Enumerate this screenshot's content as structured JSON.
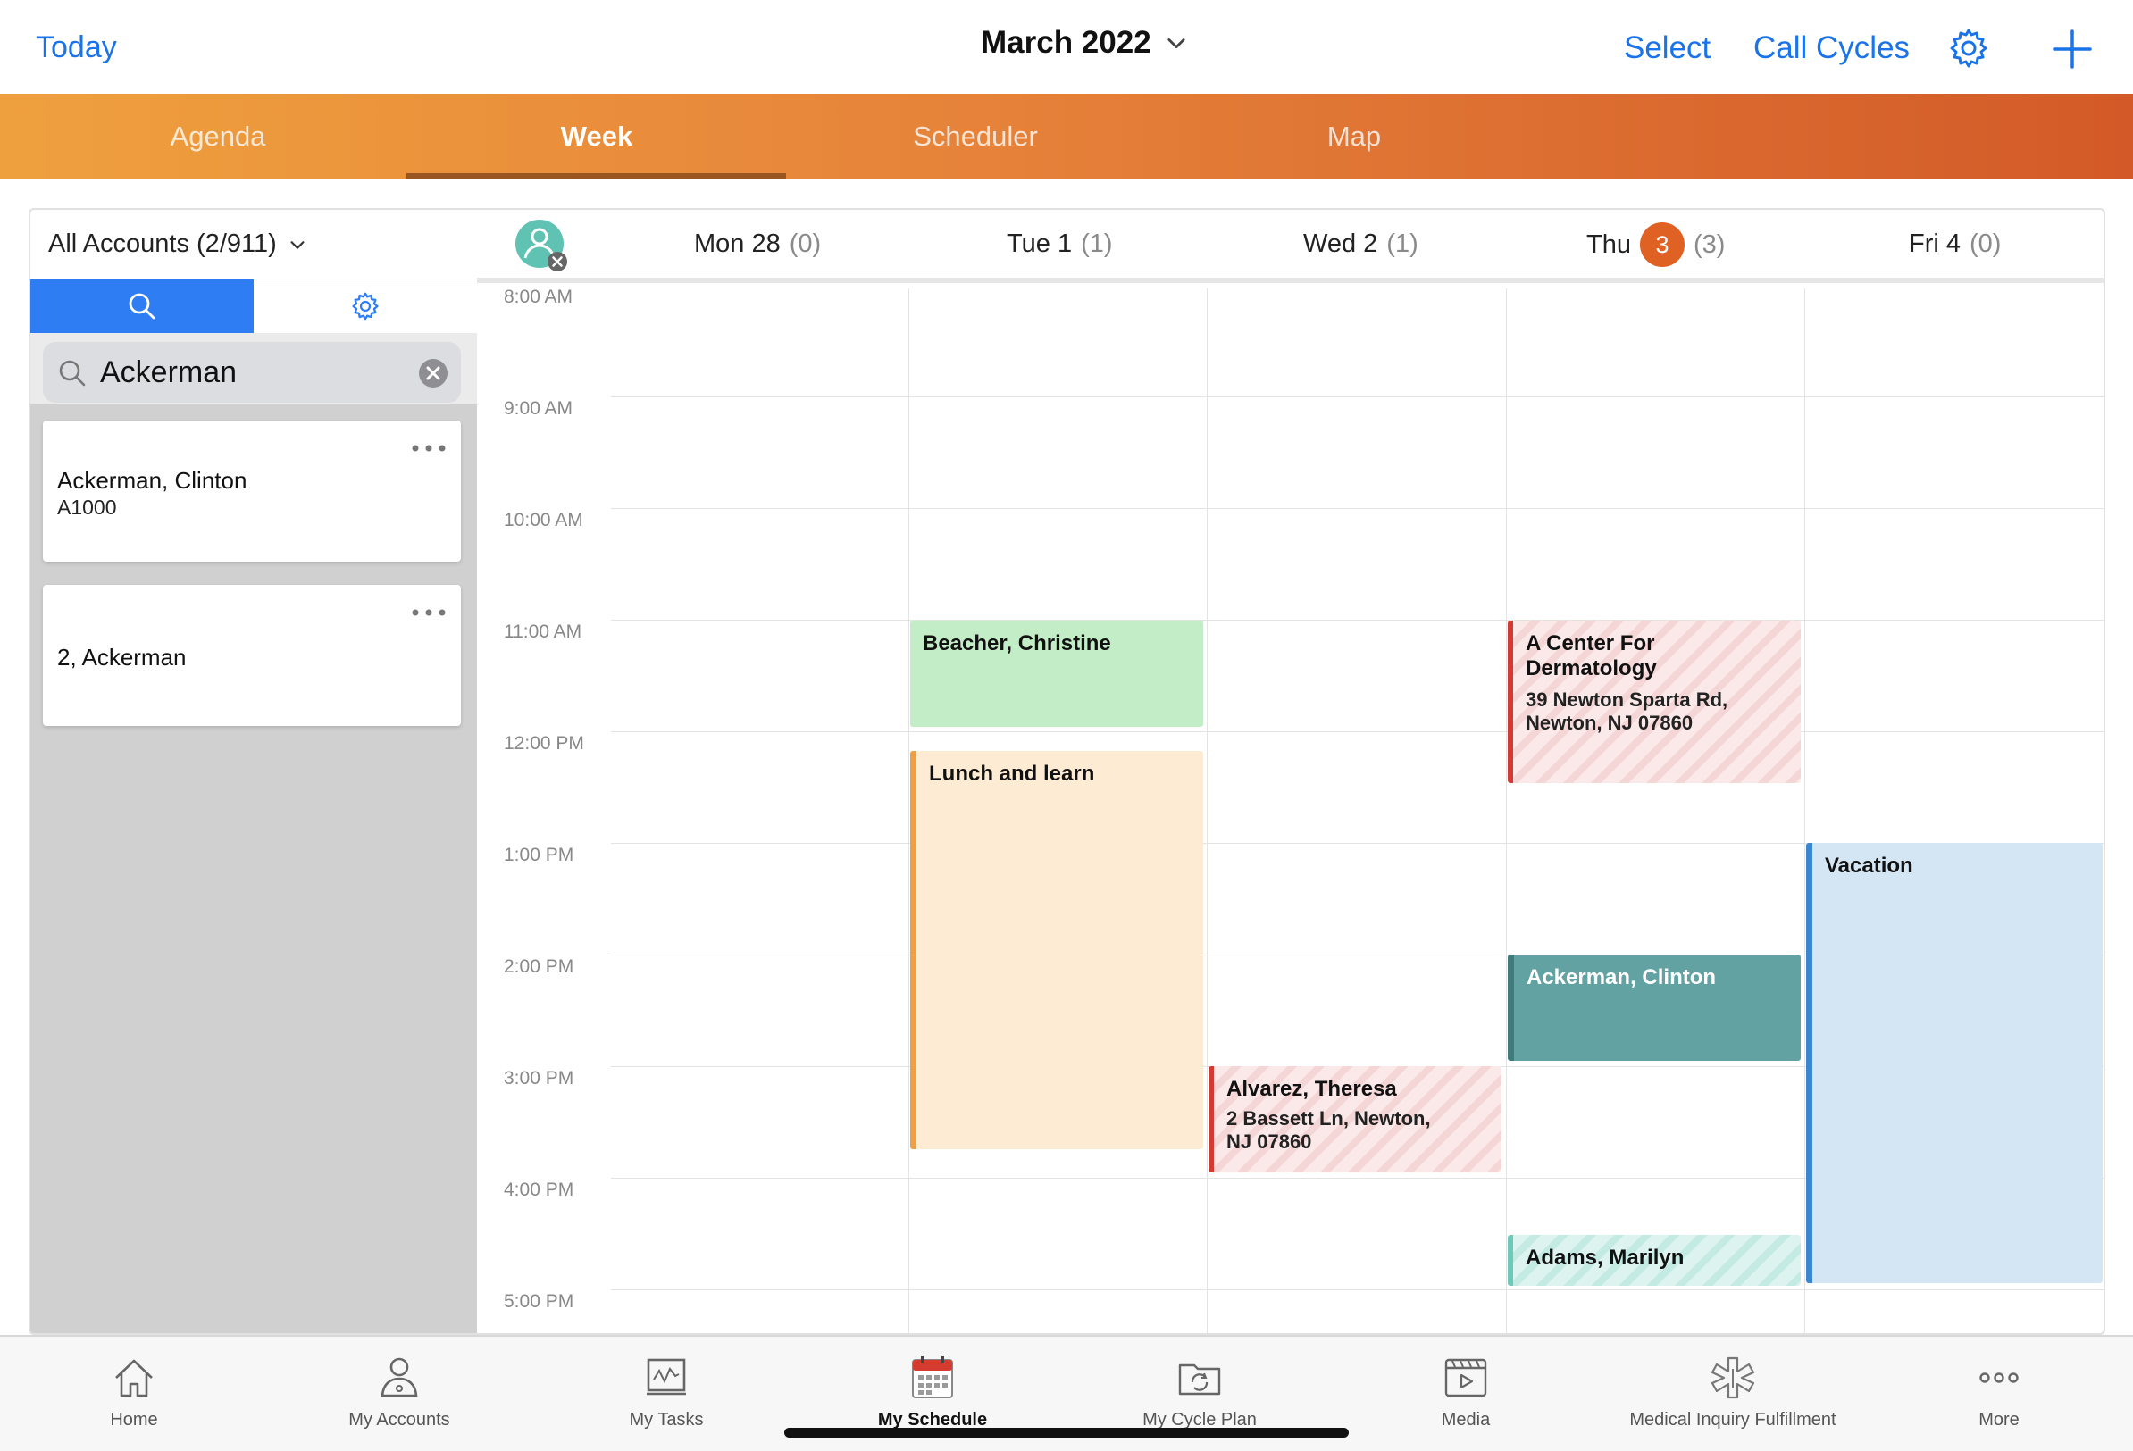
{
  "topnav": {
    "today_label": "Today",
    "month_title": "March 2022",
    "select_label": "Select",
    "call_cycles_label": "Call Cycles"
  },
  "tabs": [
    {
      "label": "Agenda",
      "active": false
    },
    {
      "label": "Week",
      "active": true
    },
    {
      "label": "Scheduler",
      "active": false
    },
    {
      "label": "Map",
      "active": false
    }
  ],
  "left_panel": {
    "accounts_filter": "All Accounts (2/911)",
    "search_value": "Ackerman",
    "results": [
      {
        "name": "Ackerman, Clinton",
        "id": "A1000"
      },
      {
        "name": "2, Ackerman",
        "id": ""
      }
    ]
  },
  "days": [
    {
      "name": "Mon 28",
      "count": "(0)"
    },
    {
      "name": "Tue 1",
      "count": "(1)"
    },
    {
      "name": "Wed 2",
      "count": "(1)"
    },
    {
      "name": "Thu",
      "date_badge": "3",
      "count": "(3)"
    },
    {
      "name": "Fri 4",
      "count": "(0)"
    }
  ],
  "times": [
    "8:00 AM",
    "9:00 AM",
    "10:00 AM",
    "11:00 AM",
    "12:00 PM",
    "1:00 PM",
    "2:00 PM",
    "3:00 PM",
    "4:00 PM",
    "5:00 PM"
  ],
  "events": {
    "beacher": {
      "title": "Beacher, Christine"
    },
    "lunch": {
      "title": "Lunch and learn"
    },
    "alvarez": {
      "title": "Alvarez, Theresa",
      "address": "2 Bassett Ln, Newton,",
      "address2": "NJ 07860"
    },
    "dermatology": {
      "title": "A Center For",
      "title2": "Dermatology",
      "address": "39 Newton Sparta Rd,",
      "address2": "Newton, NJ 07860"
    },
    "ackerman": {
      "title": "Ackerman, Clinton"
    },
    "adams": {
      "title": "Adams, Marilyn"
    },
    "vacation": {
      "title": "Vacation"
    }
  },
  "colors": {
    "accent_blue": "#1a73e8",
    "today_badge": "#e06124",
    "event_green": "#c3edc6",
    "event_lunch": "#fdebd3",
    "event_lunch_bar": "#eda044",
    "event_teal": "#62a2a2",
    "event_vacation": "#d4e6f4",
    "event_vacation_bar": "#3a86d0"
  },
  "bottom_tabs": [
    {
      "label": "Home",
      "icon": "home-icon"
    },
    {
      "label": "My Accounts",
      "icon": "accounts-icon"
    },
    {
      "label": "My Tasks",
      "icon": "tasks-icon"
    },
    {
      "label": "My Schedule",
      "icon": "calendar-icon",
      "active": true
    },
    {
      "label": "My Cycle Plan",
      "icon": "cycle-plan-icon"
    },
    {
      "label": "Media",
      "icon": "media-icon"
    },
    {
      "label": "Medical Inquiry Fulfillment",
      "icon": "medical-icon"
    },
    {
      "label": "More",
      "icon": "more-icon"
    }
  ]
}
